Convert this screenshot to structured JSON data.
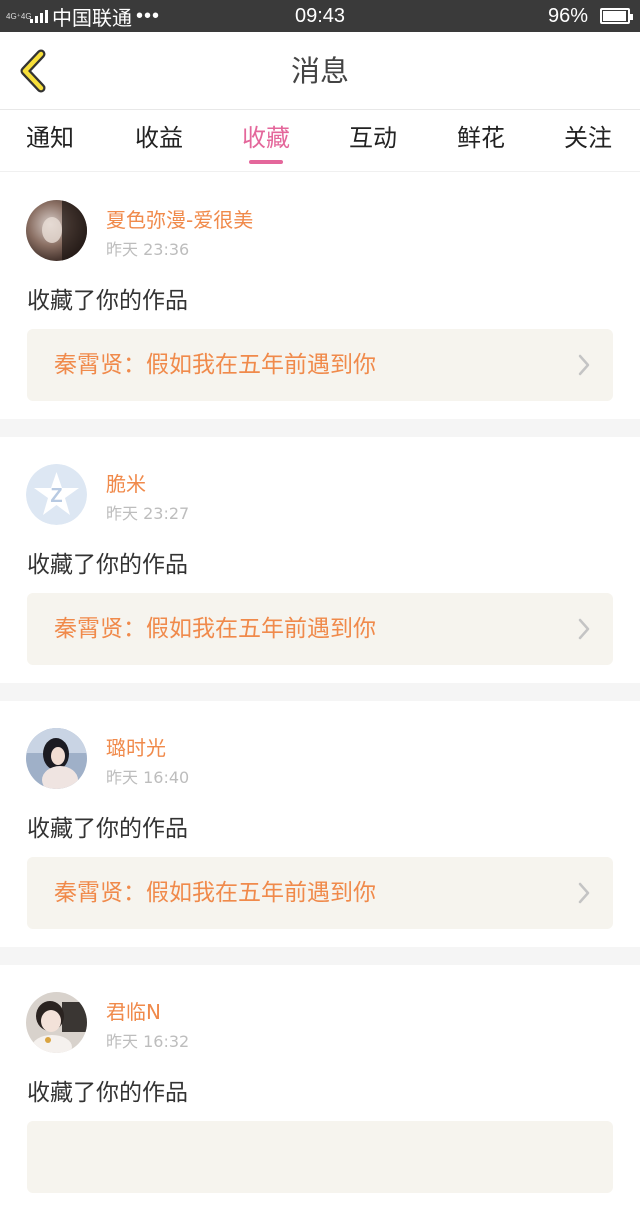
{
  "status_bar": {
    "network": "4G⁺4G",
    "carrier": "中国联通",
    "dots": "•••",
    "time": "09:43",
    "battery": "96%",
    "battery_level": 0.96
  },
  "header": {
    "title": "消息",
    "back_icon": "chevron-left-icon"
  },
  "tabs": [
    {
      "label": "通知",
      "active": false
    },
    {
      "label": "收益",
      "active": false
    },
    {
      "label": "收藏",
      "active": true
    },
    {
      "label": "互动",
      "active": false
    },
    {
      "label": "鲜花",
      "active": false
    },
    {
      "label": "关注",
      "active": false
    }
  ],
  "colors": {
    "accent": "#e4679b",
    "name_orange": "#f08a4b",
    "card_bg": "#f6f4ee"
  },
  "messages": [
    {
      "user": "夏色弥漫-爱很美",
      "time": "昨天 23:36",
      "action": "收藏了你的作品",
      "work": "秦霄贤：假如我在五年前遇到你",
      "avatar": "photo-avatar"
    },
    {
      "user": "脆米",
      "time": "昨天 23:27",
      "action": "收藏了你的作品",
      "work": "秦霄贤：假如我在五年前遇到你",
      "avatar": "default-avatar"
    },
    {
      "user": "璐时光",
      "time": "昨天 16:40",
      "action": "收藏了你的作品",
      "work": "秦霄贤：假如我在五年前遇到你",
      "avatar": "photo-avatar"
    },
    {
      "user": "君临N",
      "time": "昨天 16:32",
      "action": "收藏了你的作品",
      "work": "",
      "avatar": "photo-avatar"
    }
  ]
}
